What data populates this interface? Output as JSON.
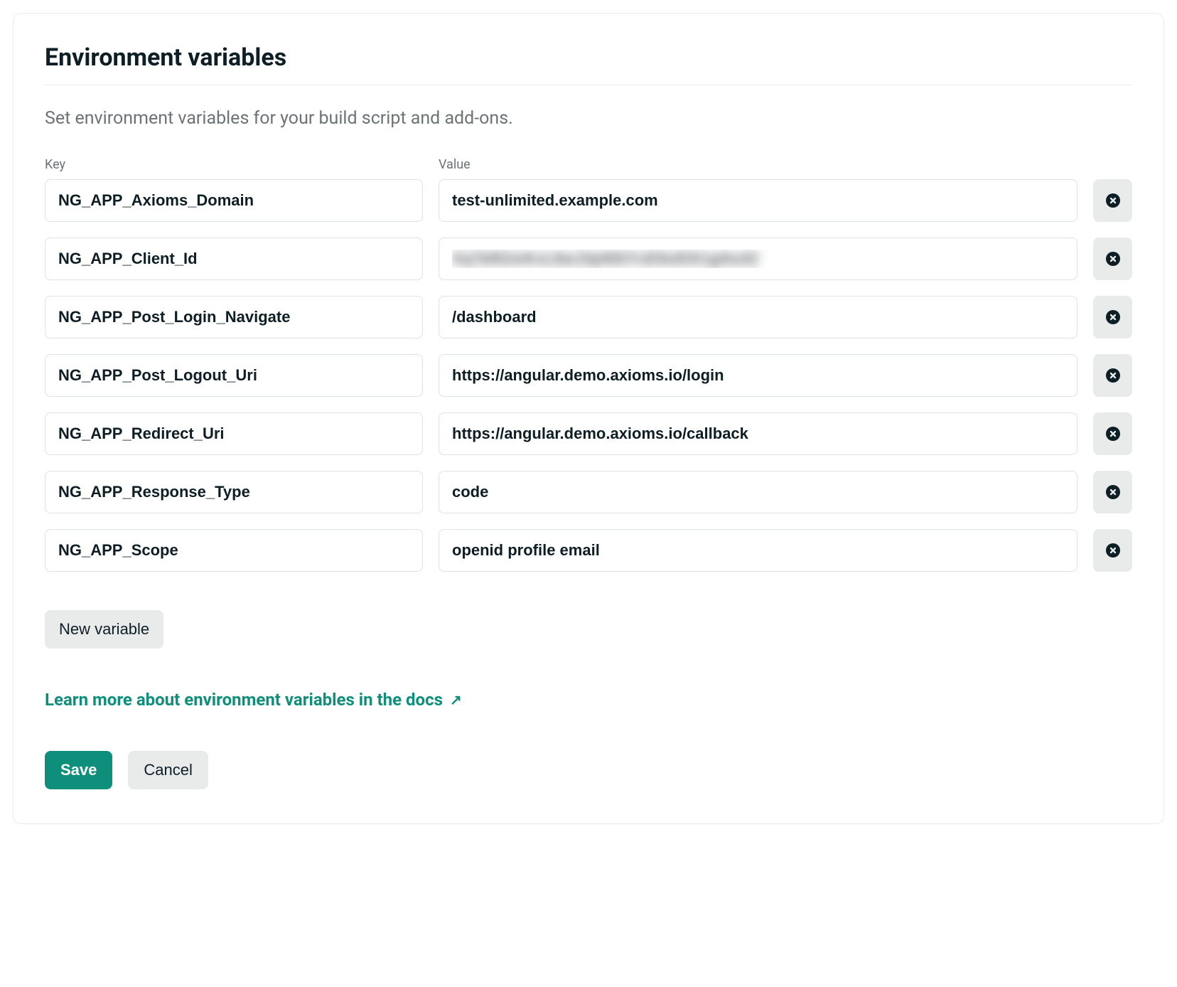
{
  "title": "Environment variables",
  "description": "Set environment variables for your build script and add-ons.",
  "labels": {
    "key": "Key",
    "value": "Value"
  },
  "rows": [
    {
      "key": "NG_APP_Axioms_Domain",
      "value": "test-unlimited.example.com",
      "blurred": false
    },
    {
      "key": "NG_APP_Client_Id",
      "value": "Xq7bR2mKvL8wJ3pN5tYcE9sDfA1gHu4Z",
      "blurred": true
    },
    {
      "key": "NG_APP_Post_Login_Navigate",
      "value": "/dashboard",
      "blurred": false
    },
    {
      "key": "NG_APP_Post_Logout_Uri",
      "value": "https://angular.demo.axioms.io/login",
      "blurred": false
    },
    {
      "key": "NG_APP_Redirect_Uri",
      "value": "https://angular.demo.axioms.io/callback",
      "blurred": false
    },
    {
      "key": "NG_APP_Response_Type",
      "value": "code",
      "blurred": false
    },
    {
      "key": "NG_APP_Scope",
      "value": "openid profile email",
      "blurred": false
    }
  ],
  "new_variable_label": "New variable",
  "docs_link_label": "Learn more about environment variables in the docs",
  "save_label": "Save",
  "cancel_label": "Cancel"
}
